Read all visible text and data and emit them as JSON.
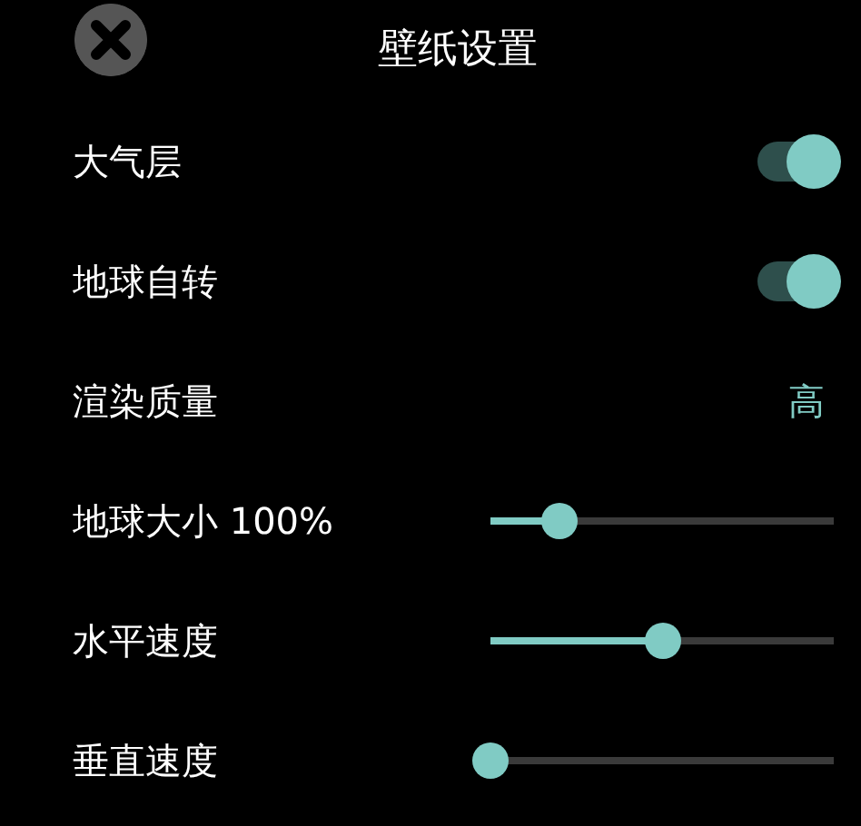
{
  "header": {
    "title": "壁纸设置"
  },
  "settings": [
    {
      "kind": "toggle",
      "label": "大气层",
      "on": true
    },
    {
      "kind": "toggle",
      "label": "地球自转",
      "on": true
    },
    {
      "kind": "value",
      "label": "渲染质量",
      "value": "高"
    },
    {
      "kind": "slider",
      "label": "地球大小 100%",
      "level": 0.2
    },
    {
      "kind": "slider",
      "label": "水平速度",
      "level": 0.5
    },
    {
      "kind": "slider",
      "label": "垂直速度",
      "level": 0
    }
  ]
}
